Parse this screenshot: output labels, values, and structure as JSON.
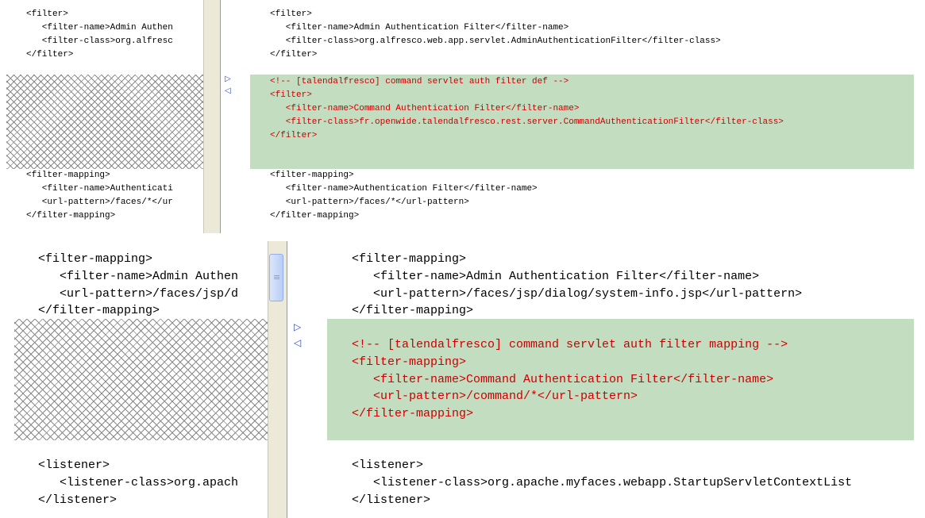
{
  "top_diff": {
    "left_lines": [
      "<filter>",
      "   <filter-name>Admin Authen",
      "   <filter-class>org.alfresc",
      "</filter>",
      "<filter-mapping>",
      "   <filter-name>Authenticati",
      "   <url-pattern>/faces/*</ur",
      "</filter-mapping>"
    ],
    "right_lines": [
      "<filter>",
      "   <filter-name>Admin Authentication Filter</filter-name>",
      "   <filter-class>org.alfresco.web.app.servlet.AdminAuthenticationFilter</filter-class>",
      "</filter>",
      "<filter-mapping>",
      "   <filter-name>Authentication Filter</filter-name>",
      "   <url-pattern>/faces/*</url-pattern>",
      "</filter-mapping>"
    ],
    "added_lines": [
      "<!-- [talendalfresco] command servlet auth filter def -->",
      "<filter>",
      "   <filter-name>Command Authentication Filter</filter-name>",
      "   <filter-class>fr.openwide.talendalfresco.rest.server.CommandAuthenticationFilter</filter-class>",
      "</filter>"
    ]
  },
  "bottom_diff": {
    "left_lines": [
      "<filter-mapping>",
      "   <filter-name>Admin Authen",
      "   <url-pattern>/faces/jsp/d",
      "</filter-mapping>",
      "<listener>",
      "   <listener-class>org.apach",
      "</listener>"
    ],
    "right_lines": [
      "<filter-mapping>",
      "   <filter-name>Admin Authentication Filter</filter-name>",
      "   <url-pattern>/faces/jsp/dialog/system-info.jsp</url-pattern>",
      "</filter-mapping>",
      "<listener>",
      "   <listener-class>org.apache.myfaces.webapp.StartupServletContextList",
      "</listener>"
    ],
    "added_lines": [
      "<!-- [talendalfresco] command servlet auth filter mapping -->",
      "<filter-mapping>",
      "   <filter-name>Command Authentication Filter</filter-name>",
      "   <url-pattern>/command/*</url-pattern>",
      "</filter-mapping>"
    ]
  },
  "icons": {
    "copy_right": "triangle-right-icon",
    "copy_left": "triangle-left-icon"
  },
  "colors": {
    "added_band": "#c3ddc0",
    "added_text": "#cc0000",
    "arrow": "#2a48c8"
  }
}
